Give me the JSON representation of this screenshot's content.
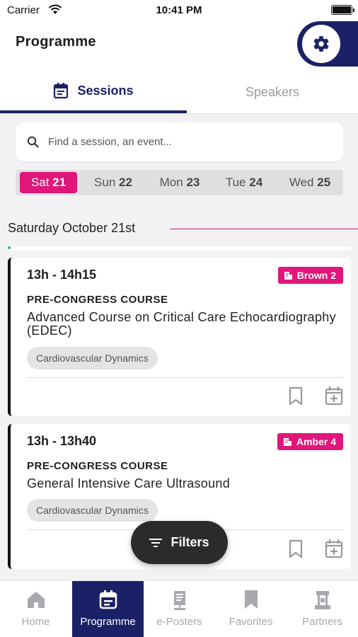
{
  "status_bar": {
    "carrier": "Carrier",
    "time": "10:41 PM"
  },
  "header": {
    "title": "Programme",
    "settings_icon": "gear-icon"
  },
  "tabs": [
    {
      "label": "Sessions",
      "icon": "calendar-icon",
      "active": true
    },
    {
      "label": "Speakers",
      "active": false
    }
  ],
  "search": {
    "placeholder": "Find a session, an event..."
  },
  "days": [
    {
      "name": "Sat",
      "num": "21",
      "active": true
    },
    {
      "name": "Sun",
      "num": "22",
      "active": false
    },
    {
      "name": "Mon",
      "num": "23",
      "active": false
    },
    {
      "name": "Tue",
      "num": "24",
      "active": false
    },
    {
      "name": "Wed",
      "num": "25",
      "active": false
    }
  ],
  "date_heading": "Saturday October 21st",
  "sessions": [
    {
      "time": "13h - 14h15",
      "room": "Brown 2",
      "type": "PRE-CONGRESS COURSE",
      "title": "Advanced Course on Critical Care Echocardiography (EDEC)",
      "topic": "Cardiovascular Dynamics"
    },
    {
      "time": "13h - 13h40",
      "room": "Amber 4",
      "type": "PRE-CONGRESS COURSE",
      "title": "General Intensive Care Ultrasound",
      "topic": "Cardiovascular Dynamics"
    }
  ],
  "filters_label": "Filters",
  "nav": [
    {
      "label": "Home",
      "icon": "home-icon",
      "active": false
    },
    {
      "label": "Programme",
      "icon": "calendar-icon",
      "active": true
    },
    {
      "label": "e-Posters",
      "icon": "poster-icon",
      "active": false
    },
    {
      "label": "Favorites",
      "icon": "bookmark-icon",
      "active": false
    },
    {
      "label": "Partners",
      "icon": "booth-icon",
      "active": false
    }
  ],
  "colors": {
    "brand_navy": "#1b2166",
    "accent_pink": "#e0167a"
  }
}
